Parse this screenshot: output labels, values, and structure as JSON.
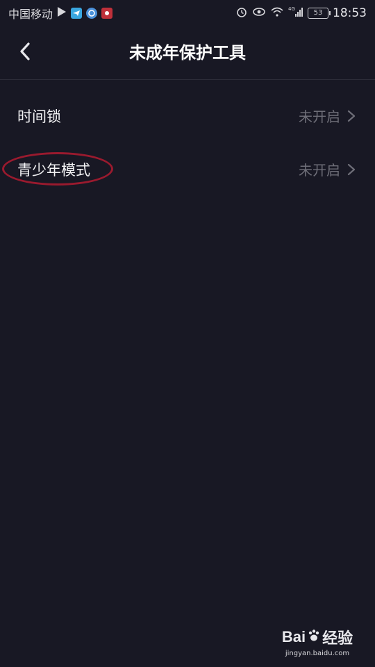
{
  "status_bar": {
    "carrier": "中国移动",
    "battery": "53",
    "time": "18:53",
    "network": "4G"
  },
  "header": {
    "title": "未成年保护工具",
    "back_icon": "chevron-left-icon"
  },
  "settings": {
    "items": [
      {
        "label": "时间锁",
        "status": "未开启"
      },
      {
        "label": "青少年模式",
        "status": "未开启"
      }
    ]
  },
  "watermark": {
    "logo_text_a": "Bai",
    "logo_text_b": "经验",
    "url": "jingyan.baidu.com"
  },
  "colors": {
    "background": "#181824",
    "highlight": "#9a1a2e",
    "muted_text": "#6e6e78"
  }
}
